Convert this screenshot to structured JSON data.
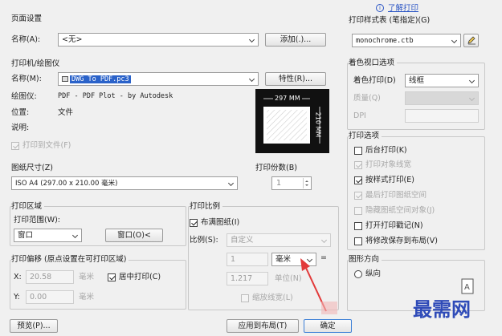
{
  "help": {
    "icon": "info-icon",
    "link": "了解打印"
  },
  "page_setup": {
    "title": "页面设置",
    "name_label": "名称(A):",
    "name_value": "<无>",
    "add_button": "添加(.)..."
  },
  "printer": {
    "title": "打印机/绘图仪",
    "name_label": "名称(M):",
    "name_value": "DWG To PDF.pc3",
    "properties_button": "特性(R)...",
    "plotter_label": "绘图仪:",
    "plotter_value": "PDF - PDF Plot - by Autodesk",
    "location_label": "位置:",
    "location_value": "文件",
    "description_label": "说明:",
    "print_to_file": "打印到文件(F)",
    "preview_width": "297 MM",
    "preview_height": "210 MM"
  },
  "paper_size": {
    "title": "图纸尺寸(Z)",
    "value": "ISO A4 (297.00 x 210.00 毫米)"
  },
  "copies": {
    "title": "打印份数(B)",
    "value": "1"
  },
  "plot_area": {
    "title": "打印区域",
    "range_label": "打印范围(W):",
    "range_value": "窗口",
    "window_button": "窗口(O)<"
  },
  "plot_scale": {
    "title": "打印比例",
    "fit_paper": "布满图纸(I)",
    "scale_label": "比例(S):",
    "scale_value": "自定义",
    "value1": "1",
    "unit": "毫米",
    "equals": "=",
    "value2": "1.217",
    "unit2": "单位(N)",
    "lineweights": "缩放线宽(L)"
  },
  "plot_offset": {
    "title": "打印偏移 (原点设置在可打印区域)",
    "x_label": "X:",
    "x_value": "20.58",
    "x_unit": "毫米",
    "center": "居中打印(C)",
    "y_label": "Y:",
    "y_value": "0.00",
    "y_unit": "毫米"
  },
  "plot_style_table": {
    "title": "打印样式表 (笔指定)(G)",
    "value": "monochrome.ctb"
  },
  "shaded_viewport": {
    "title": "着色视口选项",
    "shade_label": "着色打印(D)",
    "shade_value": "线框",
    "quality_label": "质量(Q)",
    "dpi_label": "DPI"
  },
  "plot_options": {
    "title": "打印选项",
    "items": [
      {
        "label": "后台打印(K)",
        "checked": false,
        "enabled": true
      },
      {
        "label": "打印对象线宽",
        "checked": true,
        "enabled": false
      },
      {
        "label": "按样式打印(E)",
        "checked": true,
        "enabled": true
      },
      {
        "label": "最后打印图纸空间",
        "checked": true,
        "enabled": false
      },
      {
        "label": "隐藏图纸空间对象(J)",
        "checked": false,
        "enabled": false
      },
      {
        "label": "打开打印戳记(N)",
        "checked": false,
        "enabled": true
      },
      {
        "label": "将修改保存到布局(V)",
        "checked": false,
        "enabled": true
      }
    ]
  },
  "orientation": {
    "title": "图形方向",
    "portrait": "纵向"
  },
  "footer": {
    "preview_button": "预览(P)...",
    "apply_button": "应用到布局(T)",
    "ok_button": "确定"
  },
  "watermark": "最需网",
  "colors": {
    "selection": "#2a62c9",
    "link": "#2b55c4",
    "watermark": "#2f4bb8",
    "annotation_arrow": "#e23a3a"
  }
}
